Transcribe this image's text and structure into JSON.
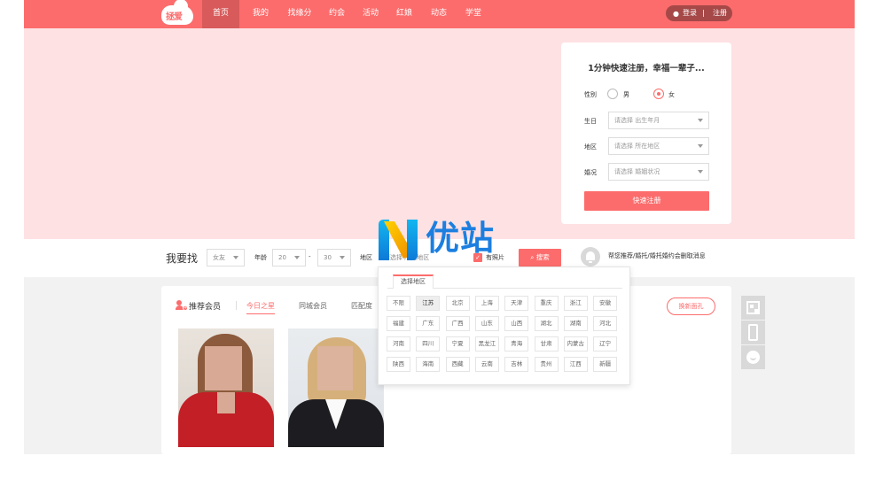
{
  "nav": {
    "logo_text": "拯爱",
    "items": [
      {
        "label": "首页",
        "active": true
      },
      {
        "label": "我的"
      },
      {
        "label": "找缘分"
      },
      {
        "label": "约会"
      },
      {
        "label": "活动"
      },
      {
        "label": "红娘"
      },
      {
        "label": "动态"
      },
      {
        "label": "学堂"
      }
    ],
    "login": "登录",
    "separator": "|",
    "register": "注册"
  },
  "register_form": {
    "title": "1分钟快速注册，幸福一辈子...",
    "gender_label": "性别",
    "gender_options": [
      "男",
      "女"
    ],
    "gender_selected": "女",
    "birth_label": "生日",
    "birth_placeholder": "请选择   出生年月",
    "region_label": "地区",
    "region_placeholder": "请选择   所在地区",
    "marriage_label": "婚况",
    "marriage_placeholder": "请选择   婚姻状况",
    "submit": "快速注册"
  },
  "search": {
    "title": "我要找",
    "gender_value": "女友",
    "age_label": "年龄",
    "age_from": "20",
    "age_sep": "-",
    "age_to": "30",
    "region_label": "地区",
    "region_placeholder": "请选择   所在地区",
    "photo_checkbox_label": "有照片",
    "search_button": "搜索",
    "notify_text": "帮您推荐/婚托/婚托婚约会删取消息"
  },
  "region_dropdown": {
    "tab": "选择地区",
    "provinces": [
      [
        "不限",
        "江苏",
        "北京",
        "上海",
        "天津",
        "重庆",
        "浙江",
        "安徽"
      ],
      [
        "福建",
        "广东",
        "广西",
        "山东",
        "山西",
        "湖北",
        "湖南",
        "河北"
      ],
      [
        "河南",
        "四川",
        "宁夏",
        "黑龙江",
        "青海",
        "甘肃",
        "内蒙古",
        "辽宁"
      ],
      [
        "陕西",
        "海南",
        "西藏",
        "云南",
        "吉林",
        "贵州",
        "江西",
        "新疆"
      ]
    ],
    "selected": "江苏"
  },
  "recommend": {
    "title": "推荐会员",
    "tabs": [
      "今日之星",
      "同城会员",
      "匹配度"
    ],
    "active_tab": "今日之星",
    "refresh": "换新面孔"
  },
  "watermark": {
    "text": "优站"
  },
  "colors": {
    "brand": "#fc6c6c",
    "hero_bg": "#fee1e3",
    "watermark_blue": "#1c7fe0"
  }
}
